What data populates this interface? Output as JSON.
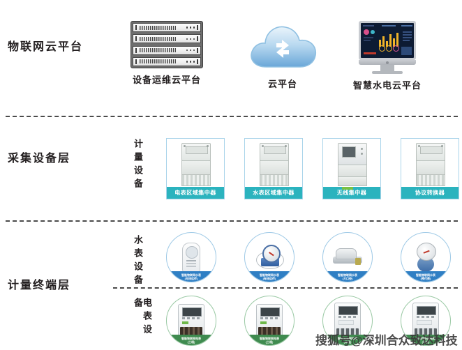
{
  "layers": [
    {
      "id": "cloud",
      "title": "物联网云平台"
    },
    {
      "id": "collect",
      "title": "采集设备层"
    },
    {
      "id": "terminal",
      "title": "计量终端层"
    }
  ],
  "vertical_labels": {
    "metering_device": "计量设备",
    "water_device": "水表设备",
    "electric_device": "电表设备"
  },
  "cloud_row": {
    "items": [
      {
        "icon": "server-rack-icon",
        "caption": "设备运维云平台"
      },
      {
        "icon": "cloud-sync-icon",
        "caption": "云平台"
      },
      {
        "icon": "desktop-dashboard-icon",
        "caption": "智慧水电云平台"
      }
    ]
  },
  "concentrators": {
    "cards": [
      {
        "icon": "concentrator-icon",
        "caption": "电表区域集中器"
      },
      {
        "icon": "concentrator-icon",
        "caption": "水表区域集中器"
      },
      {
        "icon": "concentrator-icon",
        "caption": "无线集中器"
      },
      {
        "icon": "concentrator-icon",
        "caption": "协议转换器"
      }
    ]
  },
  "water_meters": {
    "items": [
      {
        "icon": "water-meter-module-icon",
        "caption_line1": "智能物联网水表",
        "caption_line2": "(无线远传)"
      },
      {
        "icon": "water-meter-rotary-icon",
        "caption_line1": "智能物联网水表",
        "caption_line2": "(有线远传)"
      },
      {
        "icon": "water-meter-inline-icon",
        "caption_line1": "智能物联网水表",
        "caption_line2": "(大口径)"
      },
      {
        "icon": "water-meter-prepaid-icon",
        "caption_line1": "智能物联网水表",
        "caption_line2": "(预付费)"
      }
    ]
  },
  "electric_meters": {
    "items": [
      {
        "icon": "electric-meter-3p-icon",
        "caption_line1": "智能物联网电表",
        "caption_line2": "(三相)"
      },
      {
        "icon": "electric-meter-3p-alt-icon",
        "caption_line1": "智能物联网电表",
        "caption_line2": "(三相)"
      },
      {
        "icon": "electric-meter-1p-icon",
        "caption_line1": "智能物联网电表",
        "caption_line2": "(单相)"
      },
      {
        "icon": "electric-meter-din-icon",
        "caption_line1": "智能物联网电表",
        "caption_line2": "(导轨)"
      }
    ]
  },
  "watermark": {
    "text": "搜狐号@深圳合众致达科技"
  },
  "colors": {
    "card_border": "#a9d4ea",
    "card_caption_bg": "#2bb3be",
    "water_circle_border": "#9ec9e6",
    "water_caption_bg": "#2f7fc4",
    "electric_circle_border": "#9ac9a4",
    "electric_caption_bg": "#3f8b4f",
    "divider": "#4a4a4a",
    "text": "#231f20"
  }
}
